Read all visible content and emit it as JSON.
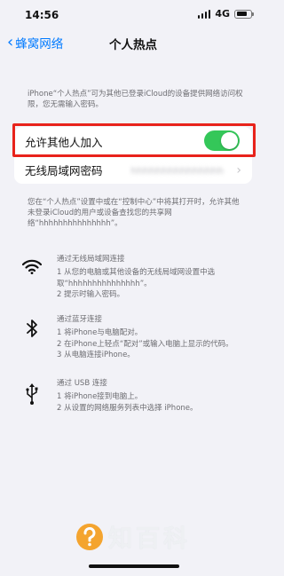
{
  "status_bar": {
    "time": "14:56",
    "network": "4G",
    "icons": [
      "signal-icon",
      "battery-icon"
    ]
  },
  "nav": {
    "back_label": "蜂窝网络",
    "title": "个人热点"
  },
  "top_description": "iPhone“个人热点”可为其他已登录iCloud的设备提供网络访问权限，您无需输入密码。",
  "settings": {
    "allow_others_label": "允许其他人加入",
    "allow_others_on": true,
    "wifi_password_label": "无线局域网密码",
    "wifi_password_value": "hhhhhhhhhhhhhhh"
  },
  "middle_description": "您在“个人热点”设置中或在“控制中心”中将其打开时，允许其他未登录iCloud的用户或设备查找您的共享网络“hhhhhhhhhhhhhhh”。",
  "methods": [
    {
      "icon": "wifi-icon",
      "title": "通过无线局域网连接",
      "steps": [
        "1 从您的电脑或其他设备的无线局域网设置中选取“hhhhhhhhhhhhhhh”。",
        "2 提示时输入密码。"
      ]
    },
    {
      "icon": "bluetooth-icon",
      "title": "通过蓝牙连接",
      "steps": [
        "1 将iPhone与电脑配对。",
        "2 在iPhone上轻点“配对”或输入电脑上显示的代码。",
        "3 从电脑连接iPhone。"
      ]
    },
    {
      "icon": "usb-icon",
      "title": "通过 USB 连接",
      "steps": [
        "1 将iPhone接到电脑上。",
        "2 从设置的网络服务列表中选择 iPhone。"
      ]
    }
  ],
  "watermark": {
    "text": "知百科",
    "icon": "question-mark-icon"
  },
  "colors": {
    "accent": "#007aff",
    "toggle_on": "#34c759",
    "highlight": "#e8231b",
    "watermark_orange": "#f59c1a"
  }
}
